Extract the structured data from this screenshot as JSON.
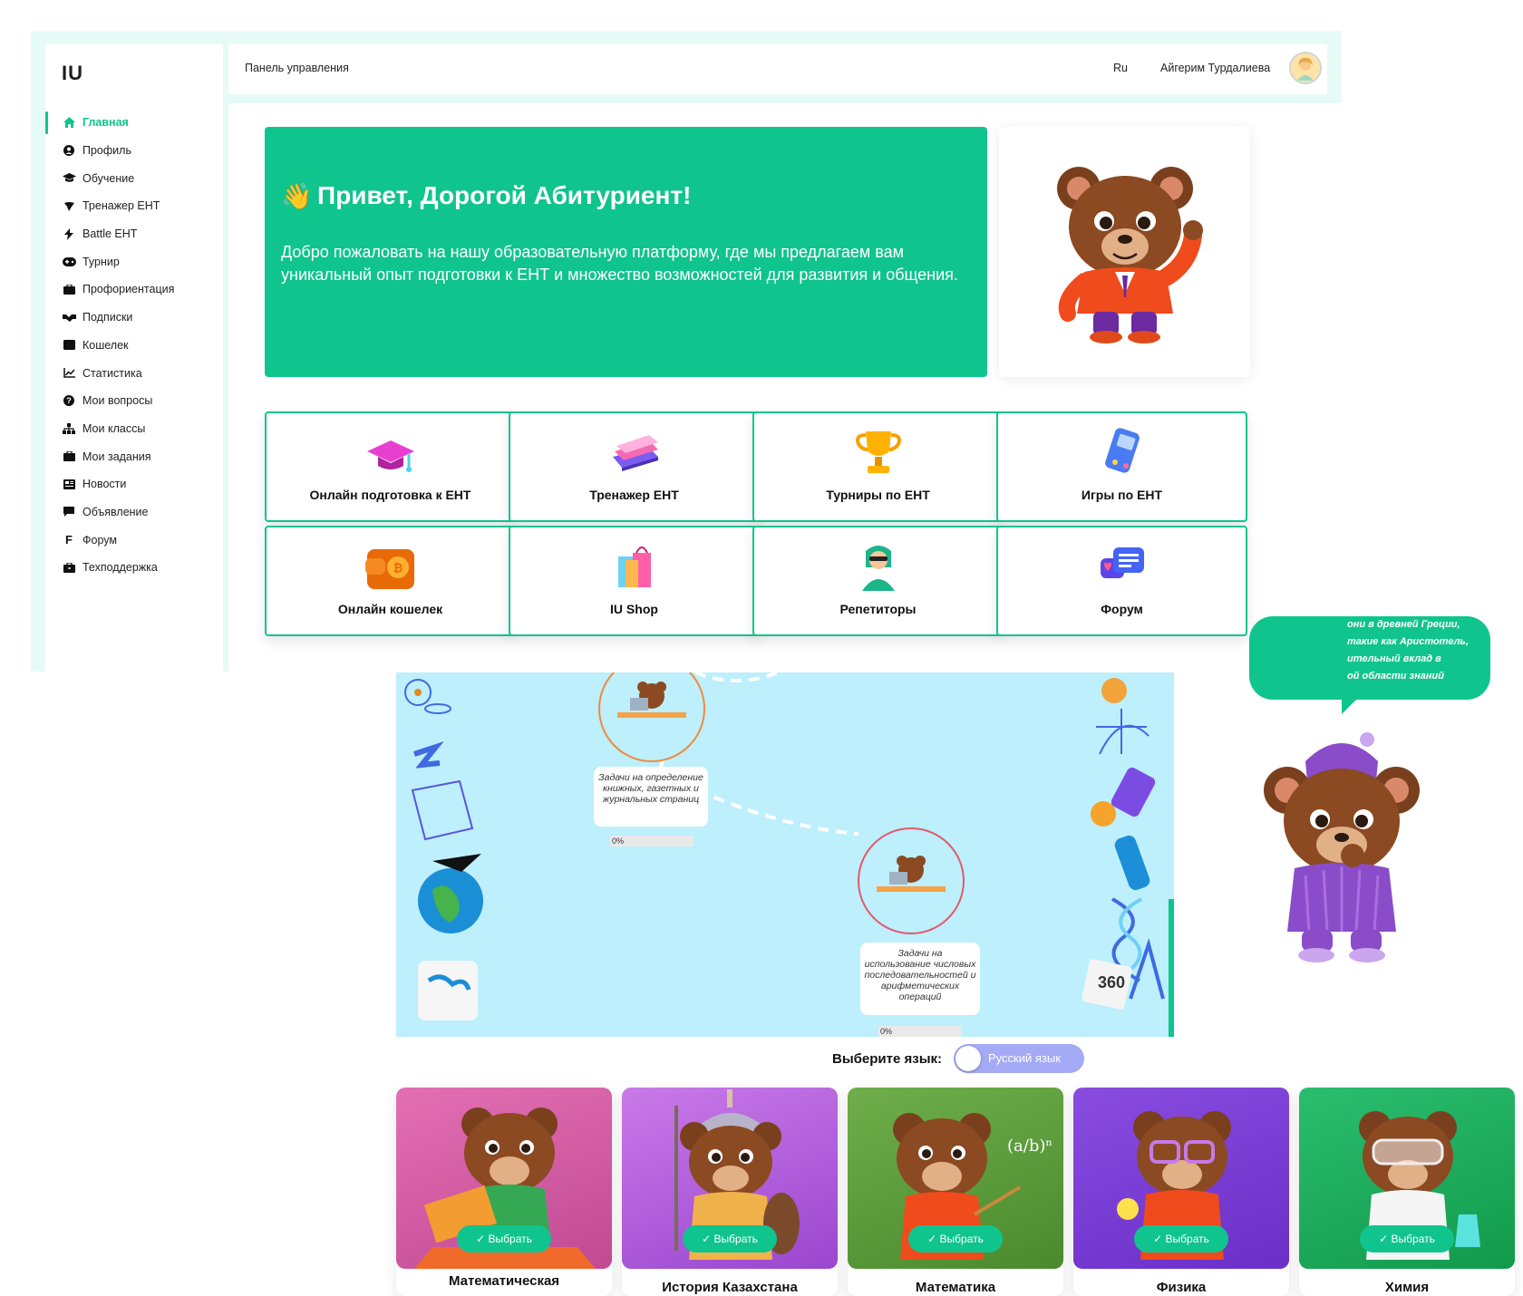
{
  "app": {
    "logo": "IU"
  },
  "sidebar": {
    "items": [
      {
        "label": "Главная",
        "icon": "home-icon",
        "active": true
      },
      {
        "label": "Профиль",
        "icon": "user-circle-icon"
      },
      {
        "label": "Обучение",
        "icon": "graduation-cap-icon"
      },
      {
        "label": "Тренажер ЕНТ",
        "icon": "trainer-icon"
      },
      {
        "label": "Battle ЕНТ",
        "icon": "lightning-icon"
      },
      {
        "label": "Турнир",
        "icon": "gamepad-icon"
      },
      {
        "label": "Профориентация",
        "icon": "briefcase-icon"
      },
      {
        "label": "Подписки",
        "icon": "handshake-icon"
      },
      {
        "label": "Кошелек",
        "icon": "wallet-icon"
      },
      {
        "label": "Статистика",
        "icon": "chart-line-icon"
      },
      {
        "label": "Мои вопросы",
        "icon": "question-circle-icon"
      },
      {
        "label": "Мои классы",
        "icon": "sitemap-icon"
      },
      {
        "label": "Мои задания",
        "icon": "briefcase-icon"
      },
      {
        "label": "Новости",
        "icon": "newspaper-icon"
      },
      {
        "label": "Объявление",
        "icon": "message-icon"
      },
      {
        "label": "Форум",
        "icon": "forum-f-icon"
      },
      {
        "label": "Техподдержка",
        "icon": "support-briefcase-icon"
      }
    ]
  },
  "topbar": {
    "breadcrumb": "Панель управления",
    "language": "Ru",
    "user_name": "Айгерим Турдалиева"
  },
  "hero": {
    "title": "Привет, Дорогой Абитуриент!",
    "text": "Добро пожаловать на нашу образовательную платформу, где мы предлагаем вам уникальный опыт подготовки к ЕНТ и множество возможностей для развития и общения."
  },
  "tiles": [
    {
      "label": "Онлайн подготовка к ЕНТ",
      "icon": "graduation-cap-icon"
    },
    {
      "label": "Тренажер ЕНТ",
      "icon": "books-icon"
    },
    {
      "label": "Турниры по ЕНТ",
      "icon": "trophy-icon"
    },
    {
      "label": "Игры по ЕНТ",
      "icon": "game-console-icon"
    },
    {
      "label": "Онлайн кошелек",
      "icon": "wallet-coin-icon"
    },
    {
      "label": "IU Shop",
      "icon": "shopping-bag-icon"
    },
    {
      "label": "Репетиторы",
      "icon": "tutor-icon"
    },
    {
      "label": "Форум",
      "icon": "chat-bubbles-icon"
    }
  ],
  "map": {
    "nodes": [
      {
        "label": "Задачи на определение книжных, газетных и журнальных страниц",
        "progress": "0%"
      },
      {
        "label": "Задачи на использование числовых последовательностей и арифметических операций",
        "progress": "0%"
      }
    ]
  },
  "bubble": {
    "lines": [
      "они в древней Греции,",
      "такие как Аристотель,",
      "ительный вклад в",
      "ой области знаний"
    ]
  },
  "language_select": {
    "label": "Выберите язык:",
    "value": "Русский язык"
  },
  "subjects": [
    {
      "name": "Математическая",
      "button": "Выбрать",
      "color": "#d85aa3"
    },
    {
      "name": "История Казахстана",
      "button": "Выбрать",
      "color": "#b35bd6"
    },
    {
      "name": "Математика",
      "button": "Выбрать",
      "color": "#5f9e3e"
    },
    {
      "name": "Физика",
      "button": "Выбрать",
      "color": "#7a3fd4"
    },
    {
      "name": "Химия",
      "button": "Выбрать",
      "color": "#15a55a"
    }
  ],
  "colors": {
    "accent": "#10c48d",
    "map_bg": "#bdeffd",
    "toggle": "#a4aaf5"
  }
}
